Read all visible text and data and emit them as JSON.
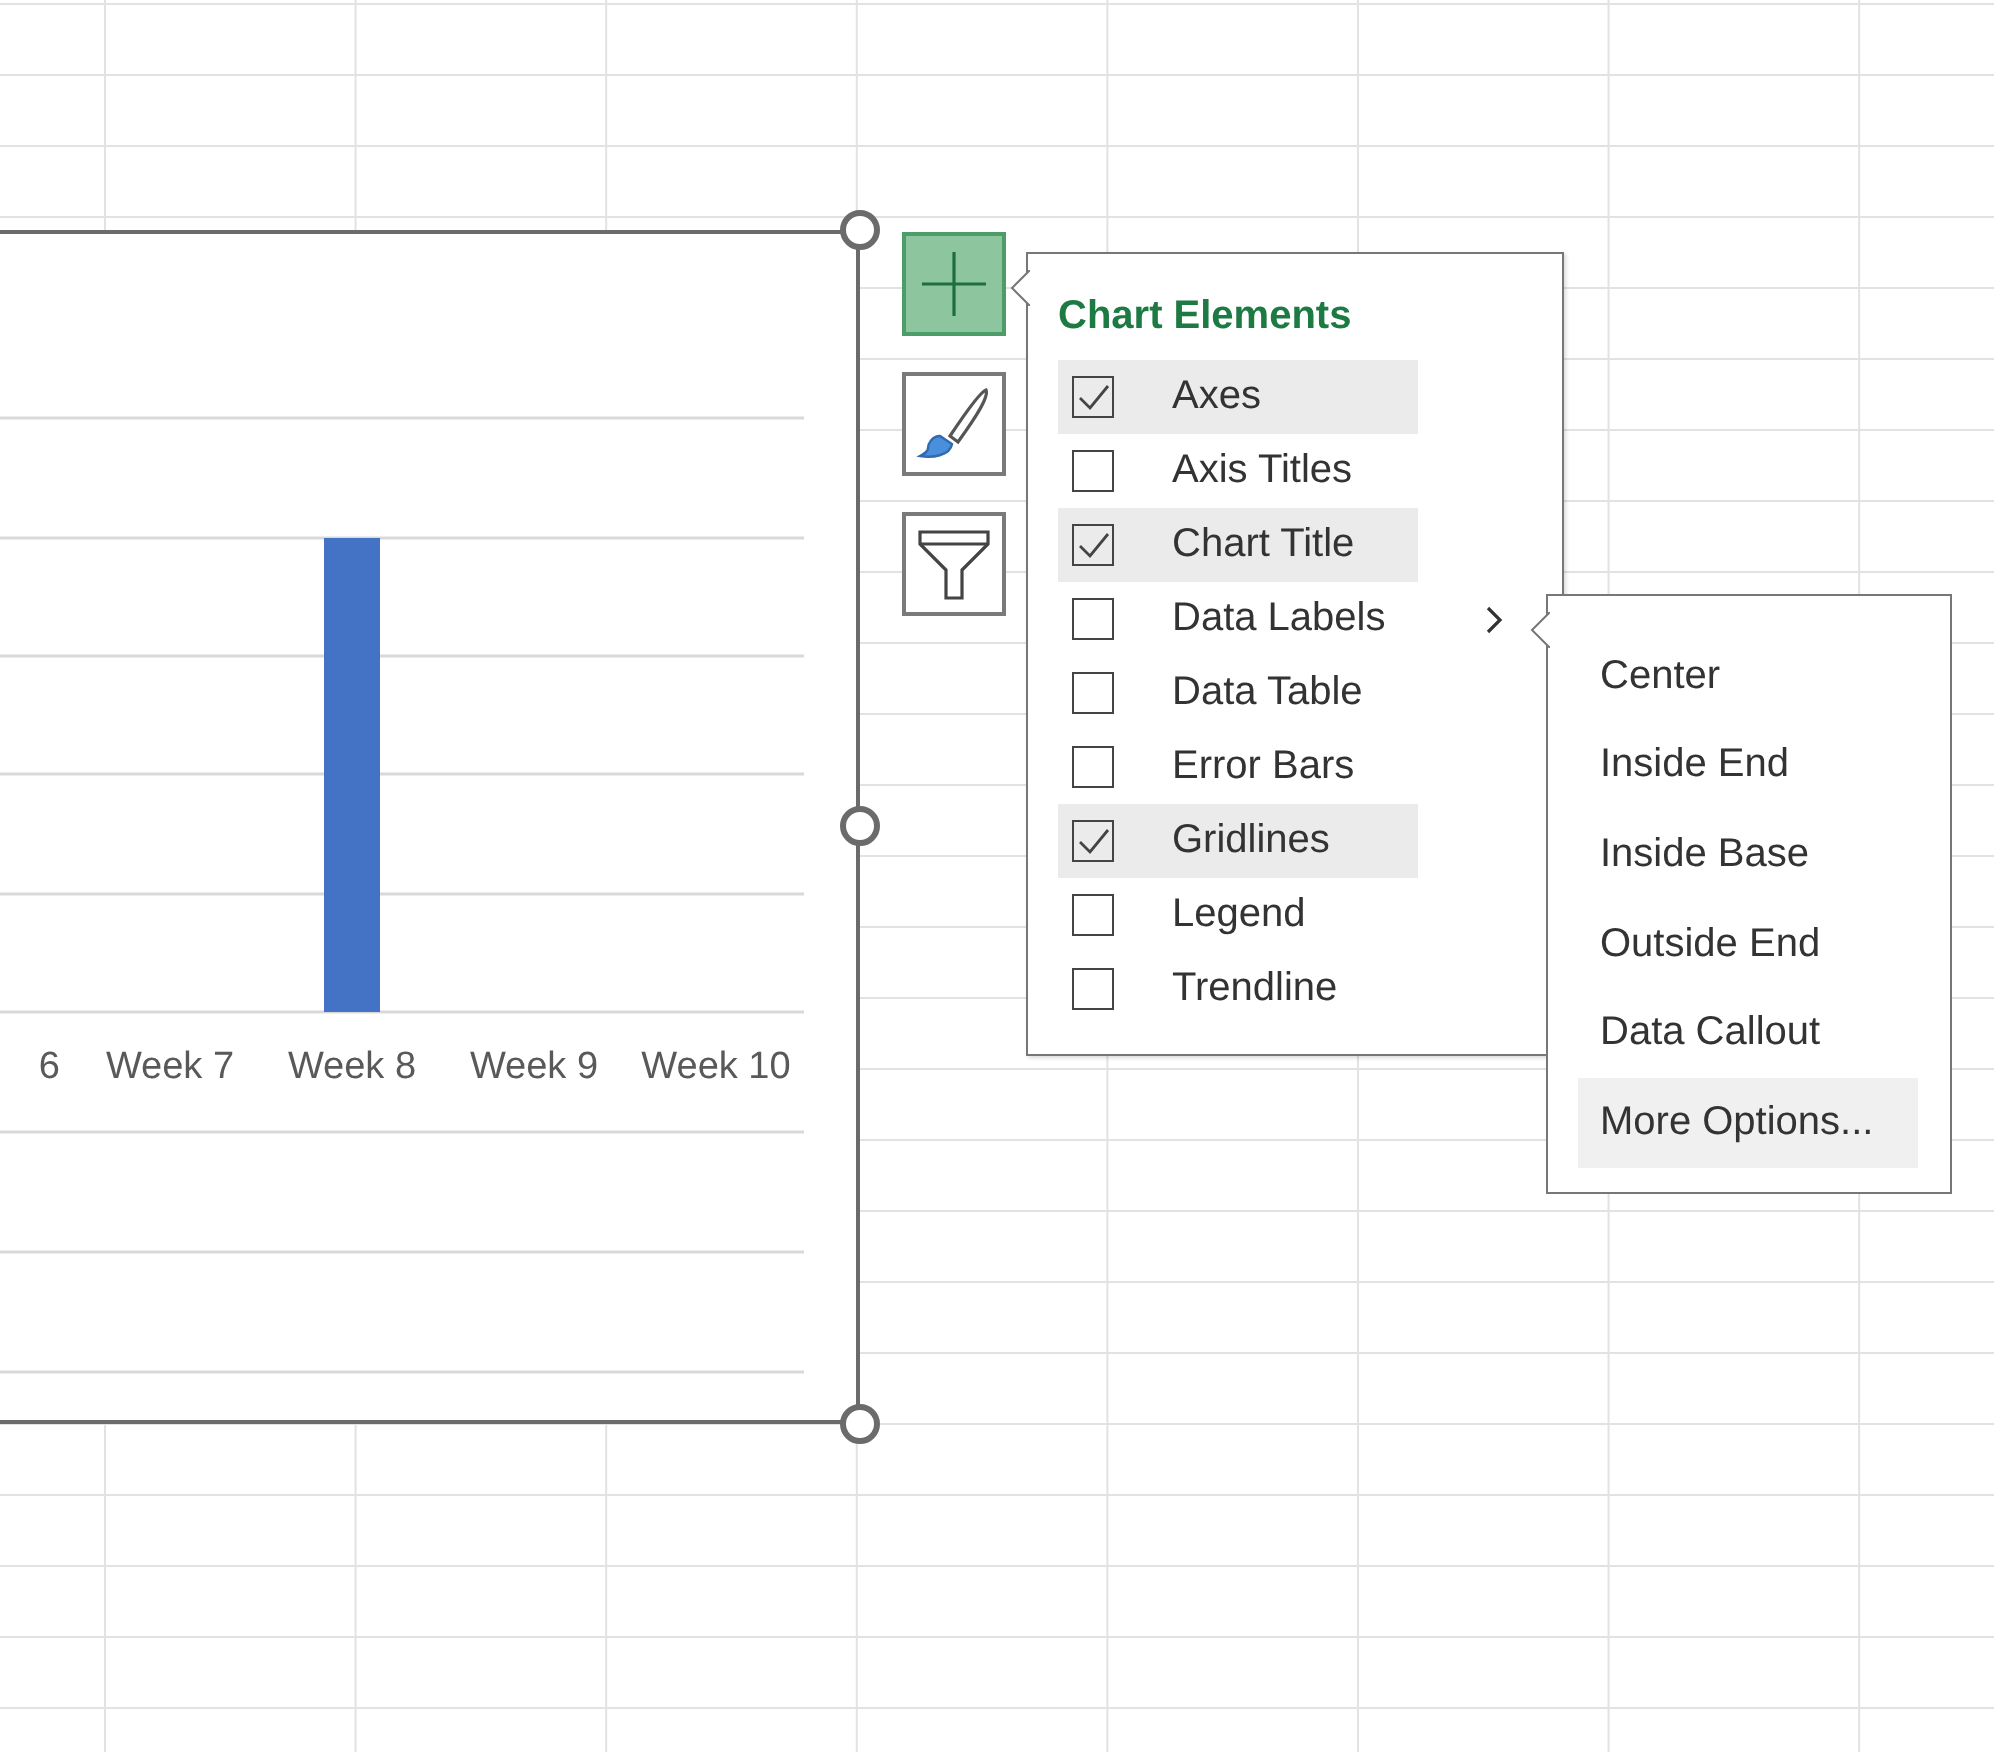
{
  "chart": {
    "x_labels": [
      "6",
      "Week 7",
      "Week 8",
      "Week 9",
      "Week 10"
    ]
  },
  "chart_buttons": [
    {
      "kind": "elements",
      "selected": true
    },
    {
      "kind": "styles",
      "selected": false
    },
    {
      "kind": "filters",
      "selected": false
    }
  ],
  "chart_elements": {
    "title": "Chart Elements",
    "items": [
      {
        "label": "Axes",
        "checked": true,
        "has_submenu": false
      },
      {
        "label": "Axis Titles",
        "checked": false,
        "has_submenu": false
      },
      {
        "label": "Chart Title",
        "checked": true,
        "has_submenu": false
      },
      {
        "label": "Data Labels",
        "checked": false,
        "has_submenu": true
      },
      {
        "label": "Data Table",
        "checked": false,
        "has_submenu": false
      },
      {
        "label": "Error Bars",
        "checked": false,
        "has_submenu": false
      },
      {
        "label": "Gridlines",
        "checked": true,
        "has_submenu": false
      },
      {
        "label": "Legend",
        "checked": false,
        "has_submenu": false
      },
      {
        "label": "Trendline",
        "checked": false,
        "has_submenu": false
      }
    ]
  },
  "data_labels_menu": [
    {
      "label": "Center",
      "selected": false
    },
    {
      "label": "Inside End",
      "selected": false
    },
    {
      "label": "Inside Base",
      "selected": false
    },
    {
      "label": "Outside End",
      "selected": false
    },
    {
      "label": "Data Callout",
      "selected": false
    },
    {
      "label": "More Options...",
      "selected": true
    }
  ]
}
